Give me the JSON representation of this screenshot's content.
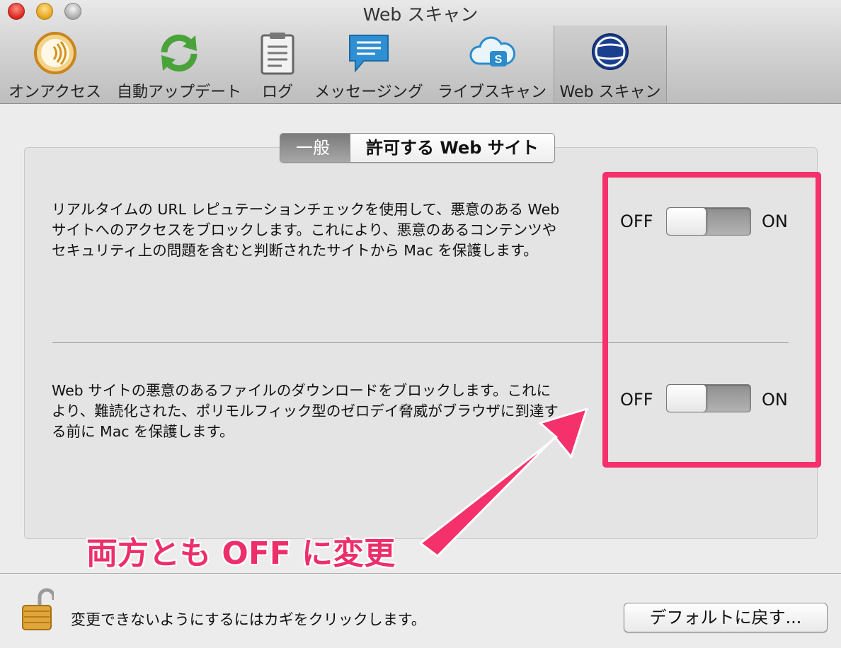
{
  "window": {
    "title": "Web スキャン"
  },
  "toolbar": {
    "items": [
      {
        "label": "オンアクセス",
        "icon": "on-access-icon"
      },
      {
        "label": "自動アップデート",
        "icon": "auto-update-icon"
      },
      {
        "label": "ログ",
        "icon": "log-clipboard-icon"
      },
      {
        "label": "メッセージング",
        "icon": "messaging-bubble-icon"
      },
      {
        "label": "ライブスキャン",
        "icon": "cloud-scan-icon"
      },
      {
        "label": "Web スキャン",
        "icon": "web-globe-icon",
        "selected": true
      }
    ]
  },
  "tabs": {
    "general": "一般",
    "allowed_sites": "許可する Web サイト",
    "selected": "general"
  },
  "settings": [
    {
      "description": "リアルタイムの URL レピュテーションチェックを使用して、悪意のある Web サイトへのアクセスをブロックします。これにより、悪意のあるコンテンツやセキュリティ上の問題を含むと判断されたサイトから Mac を保護します。",
      "off_label": "OFF",
      "on_label": "ON",
      "state": "OFF"
    },
    {
      "description": "Web サイトの悪意のあるファイルのダウンロードをブロックします。これにより、難読化された、ポリモルフィック型のゼロデイ脅威がブラウザに到達する前に Mac を保護します。",
      "off_label": "OFF",
      "on_label": "ON",
      "state": "OFF"
    }
  ],
  "annotation": {
    "text": "両方とも OFF に変更",
    "color": "#ec2f6b"
  },
  "footer": {
    "lock_text": "変更できないようにするにはカギをクリックします。",
    "default_button": "デフォルトに戻す..."
  },
  "colors": {
    "highlight": "#f5316b"
  }
}
